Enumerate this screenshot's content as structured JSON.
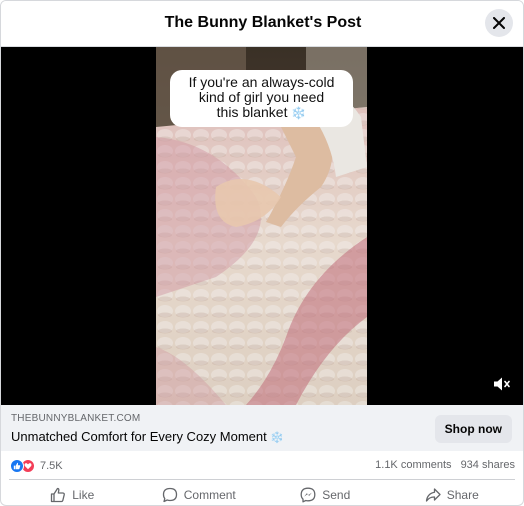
{
  "header": {
    "title": "The Bunny Blanket's Post"
  },
  "media": {
    "caption_line1": "If you're an always-cold",
    "caption_line2": "kind of girl you need",
    "caption_line3": "this blanket",
    "caption_emoji": "❄️"
  },
  "ad": {
    "domain": "THEBUNNYBLANKET.COM",
    "headline": "Unmatched Comfort for Every Cozy Moment",
    "headline_emoji": "❄️",
    "cta_label": "Shop now"
  },
  "stats": {
    "reaction_count": "7.5K",
    "comments": "1.1K comments",
    "shares": "934 shares"
  },
  "actions": {
    "like": "Like",
    "comment": "Comment",
    "send": "Send",
    "share": "Share"
  },
  "colors": {
    "like_blue": "#1877f2",
    "love_red": "#f33e58",
    "muted_text": "#65676b",
    "ad_bar_bg": "#f0f2f5"
  }
}
